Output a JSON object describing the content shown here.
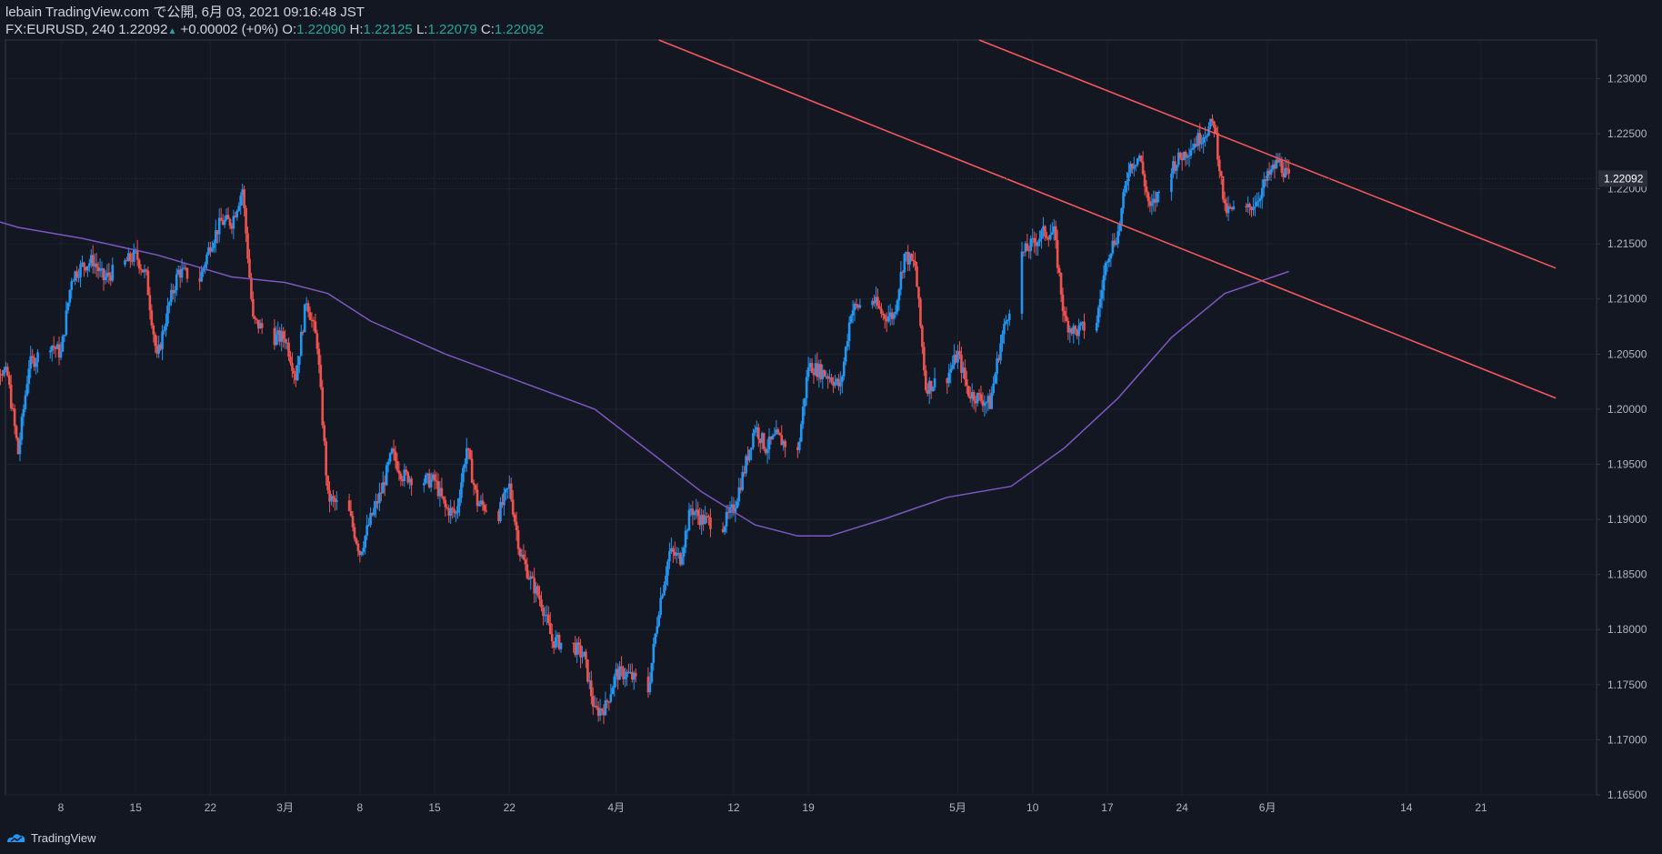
{
  "header": {
    "published": "lebain TradingView.com で公開, 6月 03, 2021 09:16:48 JST",
    "symbol": "FX:EURUSD, 240",
    "price": "1.22092",
    "change_icon": "triangle-up",
    "change": "+0.00002 (+0%)",
    "o_label": "O:",
    "o": "1.22090",
    "h_label": "H:",
    "h": "1.22125",
    "l_label": "L:",
    "l": "1.22079",
    "c_label": "C:",
    "c": "1.22092"
  },
  "footer": {
    "logo": "tradingview-logo-icon",
    "brand": "TradingView"
  },
  "colors": {
    "background": "#131722",
    "up": "#2196f3",
    "down": "#ef5350",
    "ma": "#7e57c2",
    "trendline": "#f4585a",
    "axis_text": "#b2b5be",
    "change_up": "#26a69a"
  },
  "chart_data": {
    "type": "candlestick",
    "symbol": "FX:EURUSD",
    "interval": "240",
    "ylim": [
      1.165,
      1.2335
    ],
    "y_ticks": [
      "1.23000",
      "1.22500",
      "1.22000",
      "1.21500",
      "1.21000",
      "1.20500",
      "1.20000",
      "1.19500",
      "1.19000",
      "1.18500",
      "1.18000",
      "1.17500",
      "1.17000",
      "1.16500"
    ],
    "last_price_label": "1.22092",
    "last_price": 1.22092,
    "x_ticks": [
      {
        "label": "8",
        "date": "2021-02-08"
      },
      {
        "label": "15",
        "date": "2021-02-15"
      },
      {
        "label": "22",
        "date": "2021-02-22"
      },
      {
        "label": "3月",
        "date": "2021-03-01"
      },
      {
        "label": "8",
        "date": "2021-03-08"
      },
      {
        "label": "15",
        "date": "2021-03-15"
      },
      {
        "label": "22",
        "date": "2021-03-22"
      },
      {
        "label": "4月",
        "date": "2021-04-01"
      },
      {
        "label": "12",
        "date": "2021-04-12"
      },
      {
        "label": "19",
        "date": "2021-04-19"
      },
      {
        "label": "5月",
        "date": "2021-05-03"
      },
      {
        "label": "10",
        "date": "2021-05-10"
      },
      {
        "label": "17",
        "date": "2021-05-17"
      },
      {
        "label": "24",
        "date": "2021-05-24"
      },
      {
        "label": "6月",
        "date": "2021-06-01"
      },
      {
        "label": "14",
        "date": "2021-06-14"
      },
      {
        "label": "21",
        "date": "2021-06-21"
      }
    ],
    "price_path": [
      [
        "2021-02-01",
        1.209
      ],
      [
        "2021-02-02",
        1.204
      ],
      [
        "2021-02-03",
        1.203
      ],
      [
        "2021-02-04",
        1.196
      ],
      [
        "2021-02-05",
        1.204
      ],
      [
        "2021-02-07",
        1.206
      ],
      [
        "2021-02-08",
        1.205
      ],
      [
        "2021-02-09",
        1.212
      ],
      [
        "2021-02-10",
        1.213
      ],
      [
        "2021-02-11",
        1.2135
      ],
      [
        "2021-02-12",
        1.2118
      ],
      [
        "2021-02-15",
        1.214
      ],
      [
        "2021-02-16",
        1.212
      ],
      [
        "2021-02-17",
        1.2045
      ],
      [
        "2021-02-18",
        1.209
      ],
      [
        "2021-02-19",
        1.2125
      ],
      [
        "2021-02-21",
        1.2118
      ],
      [
        "2021-02-22",
        1.215
      ],
      [
        "2021-02-23",
        1.217
      ],
      [
        "2021-02-24",
        1.217
      ],
      [
        "2021-02-25",
        1.22
      ],
      [
        "2021-02-26",
        1.208
      ],
      [
        "2021-02-28",
        1.2065
      ],
      [
        "2021-03-01",
        1.2065
      ],
      [
        "2021-03-02",
        1.203
      ],
      [
        "2021-03-03",
        1.21
      ],
      [
        "2021-03-04",
        1.206
      ],
      [
        "2021-03-05",
        1.192
      ],
      [
        "2021-03-07",
        1.1905
      ],
      [
        "2021-03-08",
        1.187
      ],
      [
        "2021-03-09",
        1.19
      ],
      [
        "2021-03-10",
        1.1925
      ],
      [
        "2021-03-11",
        1.196
      ],
      [
        "2021-03-12",
        1.194
      ],
      [
        "2021-03-14",
        1.1935
      ],
      [
        "2021-03-15",
        1.1935
      ],
      [
        "2021-03-16",
        1.191
      ],
      [
        "2021-03-17",
        1.1905
      ],
      [
        "2021-03-18",
        1.1965
      ],
      [
        "2021-03-19",
        1.1915
      ],
      [
        "2021-03-21",
        1.1905
      ],
      [
        "2021-03-22",
        1.193
      ],
      [
        "2021-03-23",
        1.187
      ],
      [
        "2021-03-24",
        1.1845
      ],
      [
        "2021-03-25",
        1.1825
      ],
      [
        "2021-03-26",
        1.179
      ],
      [
        "2021-03-28",
        1.1785
      ],
      [
        "2021-03-29",
        1.1775
      ],
      [
        "2021-03-30",
        1.1725
      ],
      [
        "2021-03-31",
        1.173
      ],
      [
        "2021-04-01",
        1.176
      ],
      [
        "2021-04-02",
        1.176
      ],
      [
        "2021-04-04",
        1.1745
      ],
      [
        "2021-04-05",
        1.182
      ],
      [
        "2021-04-06",
        1.187
      ],
      [
        "2021-04-07",
        1.1865
      ],
      [
        "2021-04-08",
        1.191
      ],
      [
        "2021-04-09",
        1.19
      ],
      [
        "2021-04-11",
        1.1895
      ],
      [
        "2021-04-12",
        1.191
      ],
      [
        "2021-04-13",
        1.1945
      ],
      [
        "2021-04-14",
        1.1985
      ],
      [
        "2021-04-15",
        1.1965
      ],
      [
        "2021-04-16",
        1.1975
      ],
      [
        "2021-04-18",
        1.196
      ],
      [
        "2021-04-19",
        1.204
      ],
      [
        "2021-04-20",
        1.2035
      ],
      [
        "2021-04-21",
        1.203
      ],
      [
        "2021-04-22",
        1.202
      ],
      [
        "2021-04-23",
        1.209
      ],
      [
        "2021-04-25",
        1.21
      ],
      [
        "2021-04-26",
        1.2085
      ],
      [
        "2021-04-27",
        1.2085
      ],
      [
        "2021-04-28",
        1.214
      ],
      [
        "2021-04-29",
        1.213
      ],
      [
        "2021-04-30",
        1.202
      ],
      [
        "2021-05-02",
        1.203
      ],
      [
        "2021-05-03",
        1.205
      ],
      [
        "2021-05-04",
        1.2015
      ],
      [
        "2021-05-05",
        1.201
      ],
      [
        "2021-05-06",
        1.2005
      ],
      [
        "2021-05-07",
        1.206
      ],
      [
        "2021-05-09",
        1.214
      ],
      [
        "2021-05-10",
        1.215
      ],
      [
        "2021-05-11",
        1.216
      ],
      [
        "2021-05-12",
        1.216
      ],
      [
        "2021-05-13",
        1.208
      ],
      [
        "2021-05-14",
        1.207
      ],
      [
        "2021-05-16",
        1.208
      ],
      [
        "2021-05-17",
        1.214
      ],
      [
        "2021-05-18",
        1.216
      ],
      [
        "2021-05-19",
        1.222
      ],
      [
        "2021-05-20",
        1.223
      ],
      [
        "2021-05-21",
        1.218
      ],
      [
        "2021-05-23",
        1.222
      ],
      [
        "2021-05-24",
        1.223
      ],
      [
        "2021-05-25",
        1.224
      ],
      [
        "2021-05-26",
        1.225
      ],
      [
        "2021-05-27",
        1.226
      ],
      [
        "2021-05-28",
        1.218
      ],
      [
        "2021-05-30",
        1.218
      ],
      [
        "2021-05-31",
        1.219
      ],
      [
        "2021-06-01",
        1.221
      ],
      [
        "2021-06-02",
        1.2225
      ],
      [
        "2021-06-03",
        1.2209
      ]
    ],
    "moving_average": [
      [
        "2021-01-28",
        1.2185
      ],
      [
        "2021-02-04",
        1.2165
      ],
      [
        "2021-02-10",
        1.2155
      ],
      [
        "2021-02-17",
        1.214
      ],
      [
        "2021-02-24",
        1.212
      ],
      [
        "2021-03-01",
        1.2115
      ],
      [
        "2021-03-05",
        1.2105
      ],
      [
        "2021-03-09",
        1.208
      ],
      [
        "2021-03-16",
        1.205
      ],
      [
        "2021-03-23",
        1.2025
      ],
      [
        "2021-03-30",
        1.2
      ],
      [
        "2021-04-05",
        1.1955
      ],
      [
        "2021-04-09",
        1.1925
      ],
      [
        "2021-04-14",
        1.1895
      ],
      [
        "2021-04-18",
        1.1885
      ],
      [
        "2021-04-21",
        1.1885
      ],
      [
        "2021-04-26",
        1.19
      ],
      [
        "2021-05-02",
        1.192
      ],
      [
        "2021-05-08",
        1.193
      ],
      [
        "2021-05-13",
        1.1965
      ],
      [
        "2021-05-18",
        1.201
      ],
      [
        "2021-05-23",
        1.2065
      ],
      [
        "2021-05-28",
        1.2105
      ],
      [
        "2021-06-03",
        1.2125
      ]
    ],
    "trendlines": [
      {
        "points": [
          [
            "2021-04-05",
            1.2335
          ],
          [
            "2021-06-28",
            1.201
          ]
        ]
      },
      {
        "points": [
          [
            "2021-05-05",
            1.2335
          ],
          [
            "2021-06-28",
            1.2128
          ]
        ]
      }
    ]
  }
}
